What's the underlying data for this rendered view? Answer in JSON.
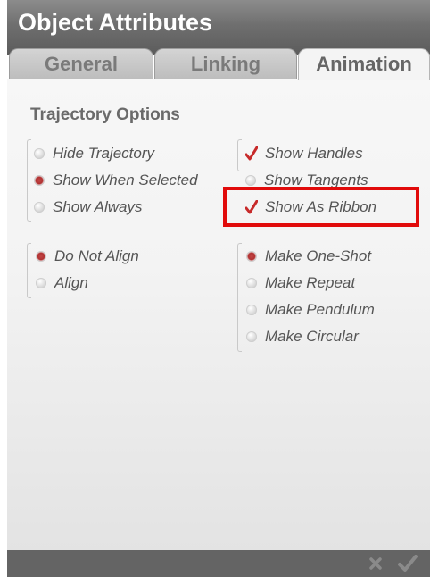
{
  "window": {
    "title": "Object Attributes"
  },
  "tabs": [
    {
      "label": "General",
      "active": false
    },
    {
      "label": "Linking",
      "active": false
    },
    {
      "label": "Animation",
      "active": true
    }
  ],
  "section": {
    "title": "Trajectory Options"
  },
  "trajectory_visibility": [
    {
      "label": "Hide Trajectory",
      "selected": false
    },
    {
      "label": "Show When Selected",
      "selected": true
    },
    {
      "label": "Show Always",
      "selected": false
    }
  ],
  "trajectory_display": [
    {
      "label": "Show Handles",
      "checked": true
    },
    {
      "label": "Show Tangents",
      "checked": false
    },
    {
      "label": "Show As Ribbon",
      "checked": true
    }
  ],
  "alignment": [
    {
      "label": "Do Not Align",
      "selected": true
    },
    {
      "label": "Align",
      "selected": false
    }
  ],
  "motion": [
    {
      "label": "Make One-Shot",
      "selected": true
    },
    {
      "label": "Make Repeat",
      "selected": false
    },
    {
      "label": "Make Pendulum",
      "selected": false
    },
    {
      "label": "Make Circular",
      "selected": false
    }
  ],
  "colors": {
    "highlight": "#e10b0b",
    "radio_selected": "#b03232",
    "title_bar": "#6f6f6f"
  },
  "icons": {
    "cancel": "close-icon",
    "confirm": "checkmark-icon"
  }
}
